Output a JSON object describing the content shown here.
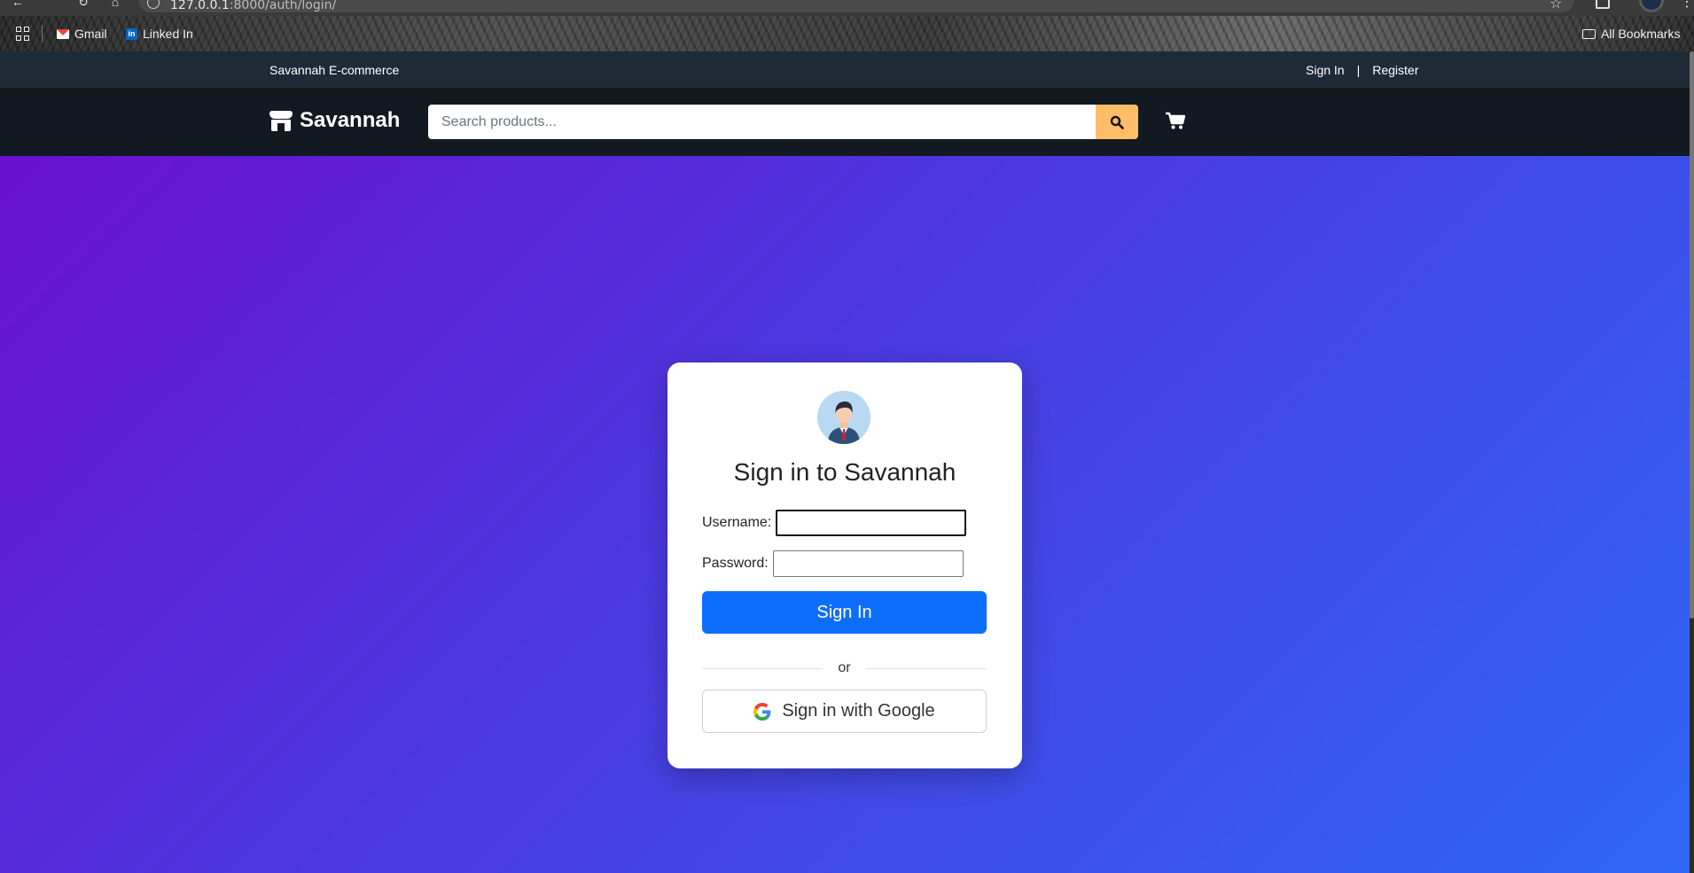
{
  "browser": {
    "url_host": "127.0.0.1",
    "url_path": ":8000/auth/login/",
    "bookmarks": [
      {
        "label": "Gmail",
        "icon": "gmail-icon"
      },
      {
        "label": "Linked In",
        "icon": "linkedin-icon"
      }
    ],
    "all_bookmarks_label": "All Bookmarks"
  },
  "topbar": {
    "brand": "Savannah E-commerce",
    "sign_in": "Sign In",
    "separator": "|",
    "register": "Register"
  },
  "navbar": {
    "logo_text": "Savannah",
    "logo_icon": "store-icon",
    "search_placeholder": "Search products...",
    "search_icon": "search-icon",
    "cart_icon": "cart-icon",
    "search_button_color": "#febd69"
  },
  "login": {
    "title": "Sign in to Savannah",
    "username_label": "Username:",
    "username_value": "",
    "password_label": "Password:",
    "password_value": "",
    "submit_label": "Sign In",
    "divider_text": "or",
    "google_label": "Sign in with Google",
    "accent_color": "#0d6efd"
  },
  "colors": {
    "topbar_bg": "#1f2a37",
    "navbar_bg": "#131921",
    "hero_gradient_start": "#6a11cb",
    "hero_gradient_end": "#2f66f5"
  }
}
